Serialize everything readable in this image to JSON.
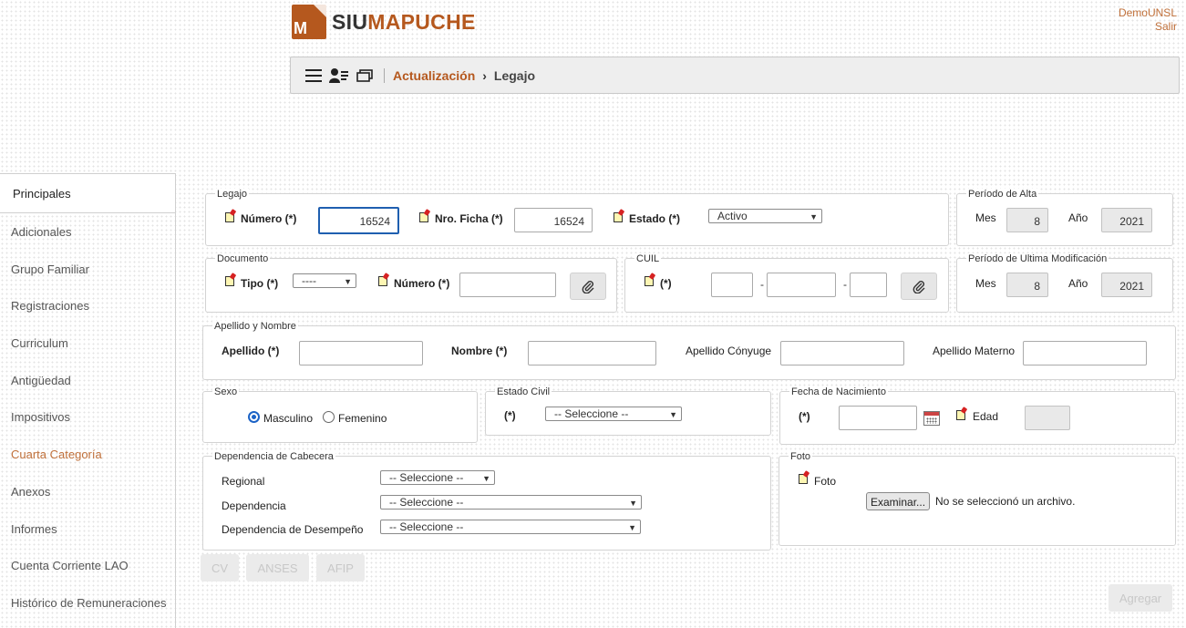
{
  "header": {
    "logo_letter": "M",
    "logo_siu": "SIU",
    "logo_mapuche": "MAPUCHE",
    "user": "DemoUNSL",
    "logout": "Salir"
  },
  "breadcrumb": {
    "section": "Actualización",
    "separator": "›",
    "current": "Legajo"
  },
  "sidebar": {
    "active": "Principales",
    "items": [
      {
        "label": "Adicionales"
      },
      {
        "label": "Grupo Familiar"
      },
      {
        "label": "Registraciones"
      },
      {
        "label": "Curriculum"
      },
      {
        "label": "Antigüedad"
      },
      {
        "label": "Impositivos"
      },
      {
        "label": "Cuarta Categoría"
      },
      {
        "label": "Anexos"
      },
      {
        "label": "Informes"
      },
      {
        "label": "Cuenta Corriente LAO"
      },
      {
        "label": "Histórico de Remuneraciones"
      }
    ]
  },
  "legajo": {
    "legend": "Legajo",
    "numero_label": "Número (*)",
    "numero_value": "16524",
    "ficha_label": "Nro. Ficha (*)",
    "ficha_value": "16524",
    "estado_label": "Estado (*)",
    "estado_value": "Activo"
  },
  "alta": {
    "legend": "Período de Alta",
    "mes_label": "Mes",
    "mes_value": "8",
    "anio_label": "Año",
    "anio_value": "2021"
  },
  "documento": {
    "legend": "Documento",
    "tipo_label": "Tipo (*)",
    "tipo_value": "----",
    "numero_label": "Número (*)",
    "numero_value": ""
  },
  "cuil": {
    "legend": "CUIL",
    "required_label": "(*)",
    "dash": "-"
  },
  "modificacion": {
    "legend": "Período de Ultima Modificación",
    "mes_label": "Mes",
    "mes_value": "8",
    "anio_label": "Año",
    "anio_value": "2021"
  },
  "nombre": {
    "legend": "Apellido y Nombre",
    "apellido_label": "Apellido (*)",
    "nombre_label": "Nombre (*)",
    "conyuge_label": "Apellido Cónyuge",
    "materno_label": "Apellido Materno"
  },
  "sexo": {
    "legend": "Sexo",
    "masculino": "Masculino",
    "femenino": "Femenino"
  },
  "estado_civil": {
    "legend": "Estado Civil",
    "required_label": "(*)",
    "value": "-- Seleccione --"
  },
  "nacimiento": {
    "legend": "Fecha de Nacimiento",
    "required_label": "(*)",
    "edad_label": "Edad"
  },
  "dependencia": {
    "legend": "Dependencia de Cabecera",
    "regional_label": "Regional",
    "regional_value": "-- Seleccione --",
    "dependencia_label": "Dependencia",
    "dependencia_value": "-- Seleccione --",
    "desempeno_label": "Dependencia de Desempeño",
    "desempeno_value": "-- Seleccione --"
  },
  "foto": {
    "legend": "Foto",
    "label": "Foto",
    "button": "Examinar...",
    "status": "No se seleccionó un archivo."
  },
  "actions": {
    "cv": "CV",
    "anses": "ANSES",
    "afip": "AFIP",
    "agregar": "Agregar"
  }
}
